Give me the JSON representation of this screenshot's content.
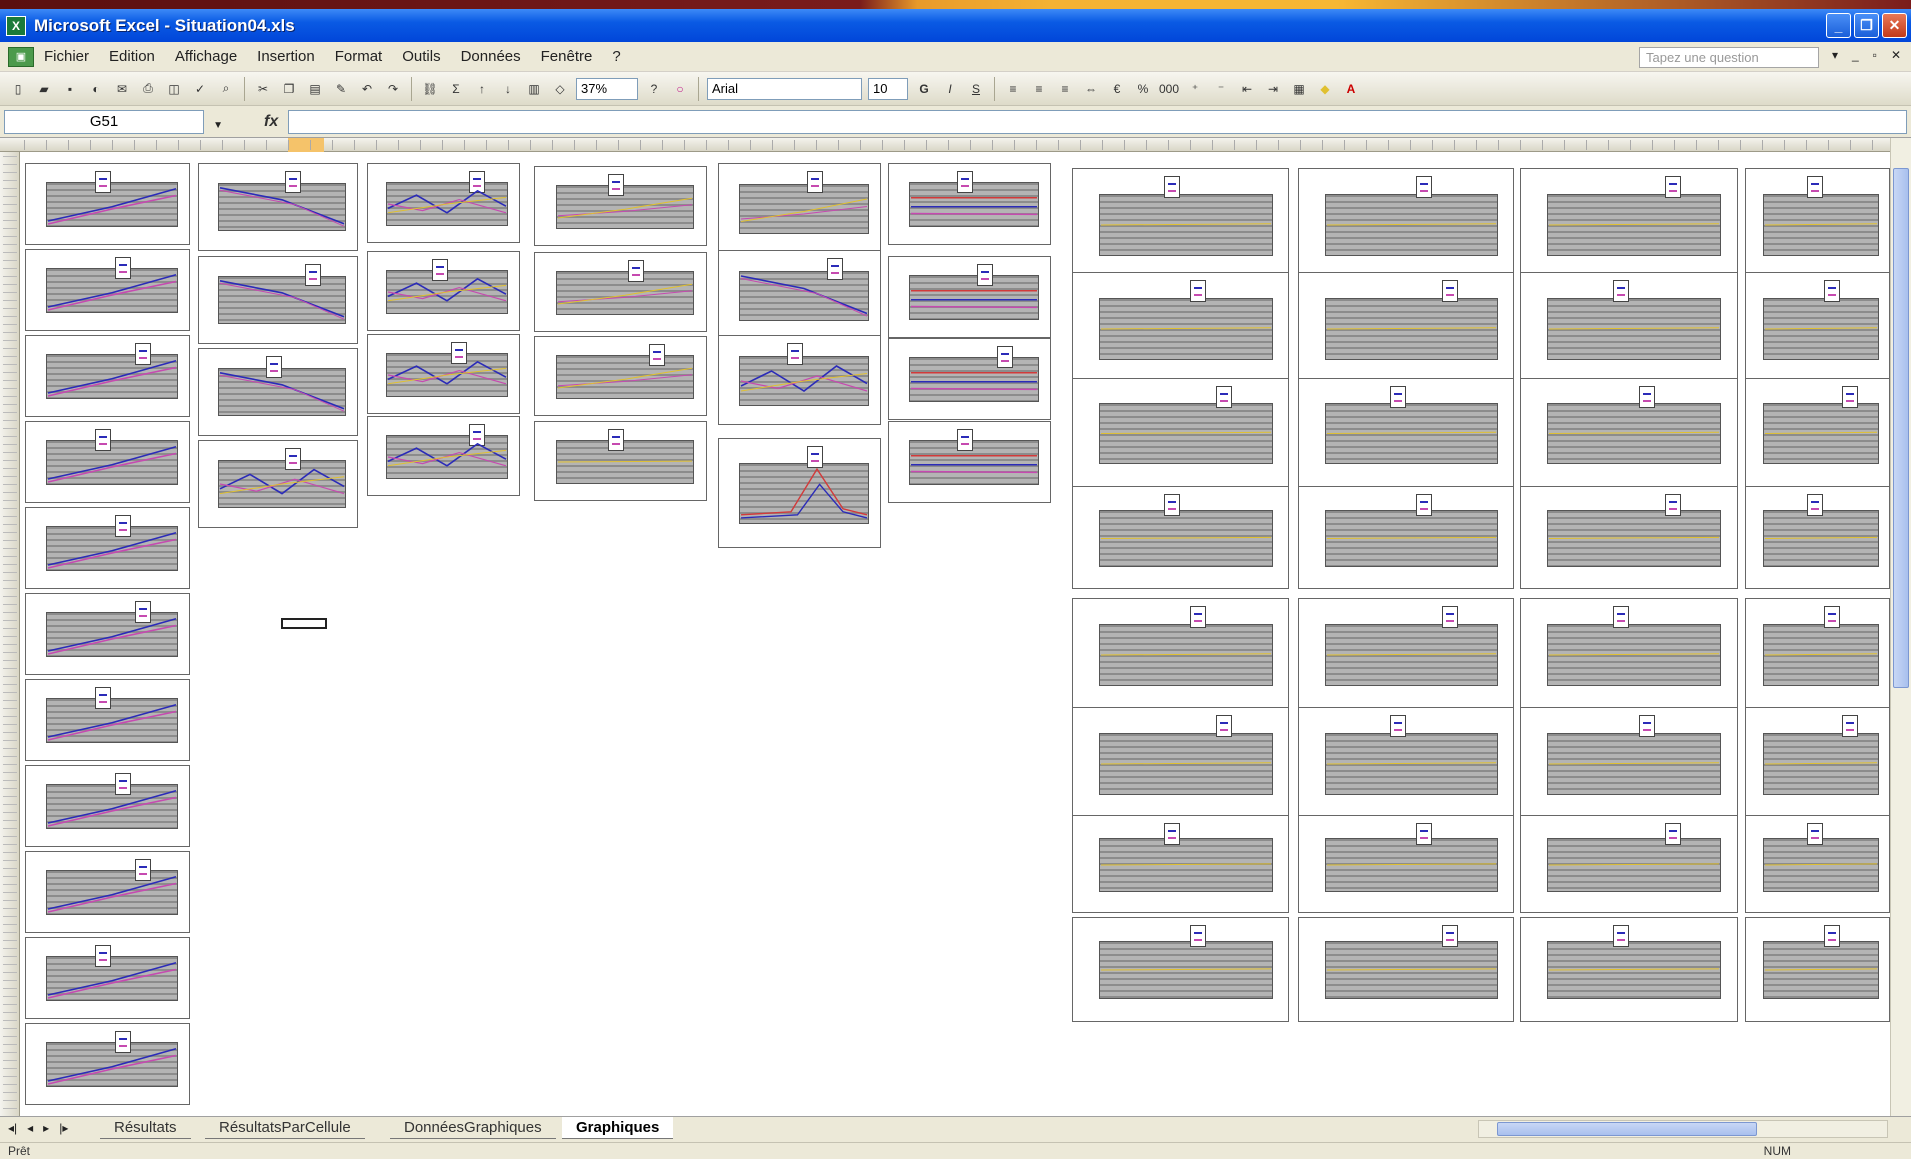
{
  "window": {
    "title": "Microsoft Excel - Situation04.xls",
    "app_icon": "excel-icon",
    "buttons": {
      "minimize": "_",
      "restore": "❐",
      "close": "✕"
    }
  },
  "menu": {
    "items": [
      "Fichier",
      "Edition",
      "Affichage",
      "Insertion",
      "Format",
      "Outils",
      "Données",
      "Fenêtre",
      "?"
    ],
    "help_placeholder": "Tapez une question"
  },
  "toolbar": {
    "zoom": "37%",
    "font": "Arial",
    "size": "10"
  },
  "formula_bar": {
    "name_box": "G51",
    "fx_label": "fx",
    "formula": ""
  },
  "sheet": {
    "charts": [],
    "colors": {
      "series_blue": "#2b2bb8",
      "series_purple": "#c64ab0",
      "series_red": "#d23a3a",
      "series_yellow": "#e0c030",
      "plot_grey": "#8c8c8c"
    }
  },
  "tabs": {
    "items": [
      "Résultats",
      "RésultatsParCellule",
      "DonnéesGraphiques",
      "Graphiques"
    ],
    "active": "Graphiques"
  },
  "status": {
    "left": "Prêt",
    "right": "NUM"
  }
}
